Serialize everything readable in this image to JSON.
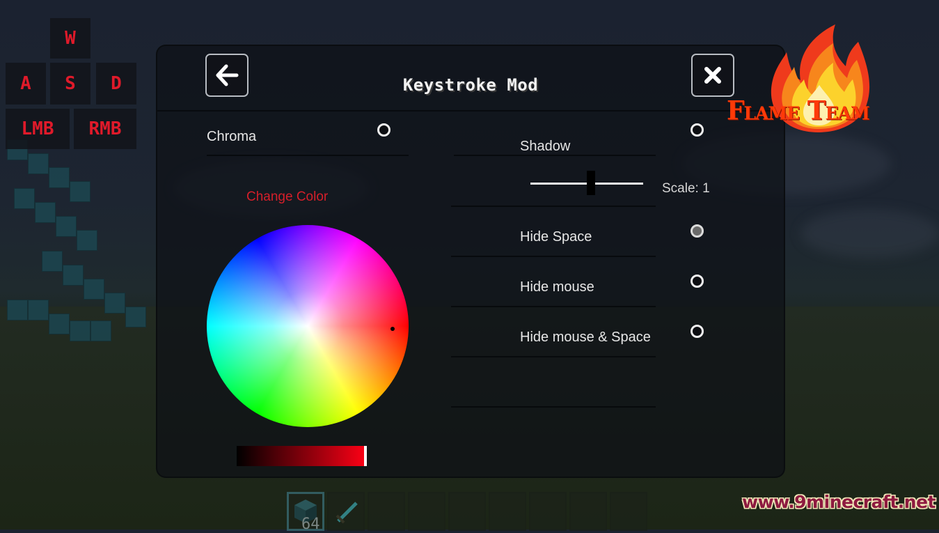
{
  "hud": {
    "keys": [
      {
        "id": "w",
        "label": "W"
      },
      {
        "id": "a",
        "label": "A"
      },
      {
        "id": "s",
        "label": "S"
      },
      {
        "id": "d",
        "label": "D"
      },
      {
        "id": "lmb",
        "label": "LMB"
      },
      {
        "id": "rmb",
        "label": "RMB"
      }
    ],
    "key_color": "#e01a2a"
  },
  "panel": {
    "title": "Keystroke Mod",
    "back_icon": "arrow-left-icon",
    "close_icon": "close-icon"
  },
  "left": {
    "chroma_label": "Chroma",
    "chroma_enabled": false,
    "change_color_label": "Change Color",
    "change_color_color": "#d51f2a",
    "selected_color": "#ff0015",
    "brightness": 1.0
  },
  "right": {
    "shadow_label": "Shadow",
    "shadow_enabled": false,
    "scale_label": "Scale: 1",
    "scale_slider_value": 0.5,
    "hide_space_label": "Hide Space",
    "hide_space_state": "partial",
    "hide_mouse_label": "Hide mouse",
    "hide_mouse_enabled": false,
    "hide_mouse_space_label": "Hide mouse & Space",
    "hide_mouse_space_enabled": false
  },
  "hotbar": {
    "slots": 9,
    "selected_slot": 0,
    "first_slot_count": "64"
  },
  "branding": {
    "logo_text": "Flame Team",
    "watermark": "www.9minecraft.net"
  }
}
